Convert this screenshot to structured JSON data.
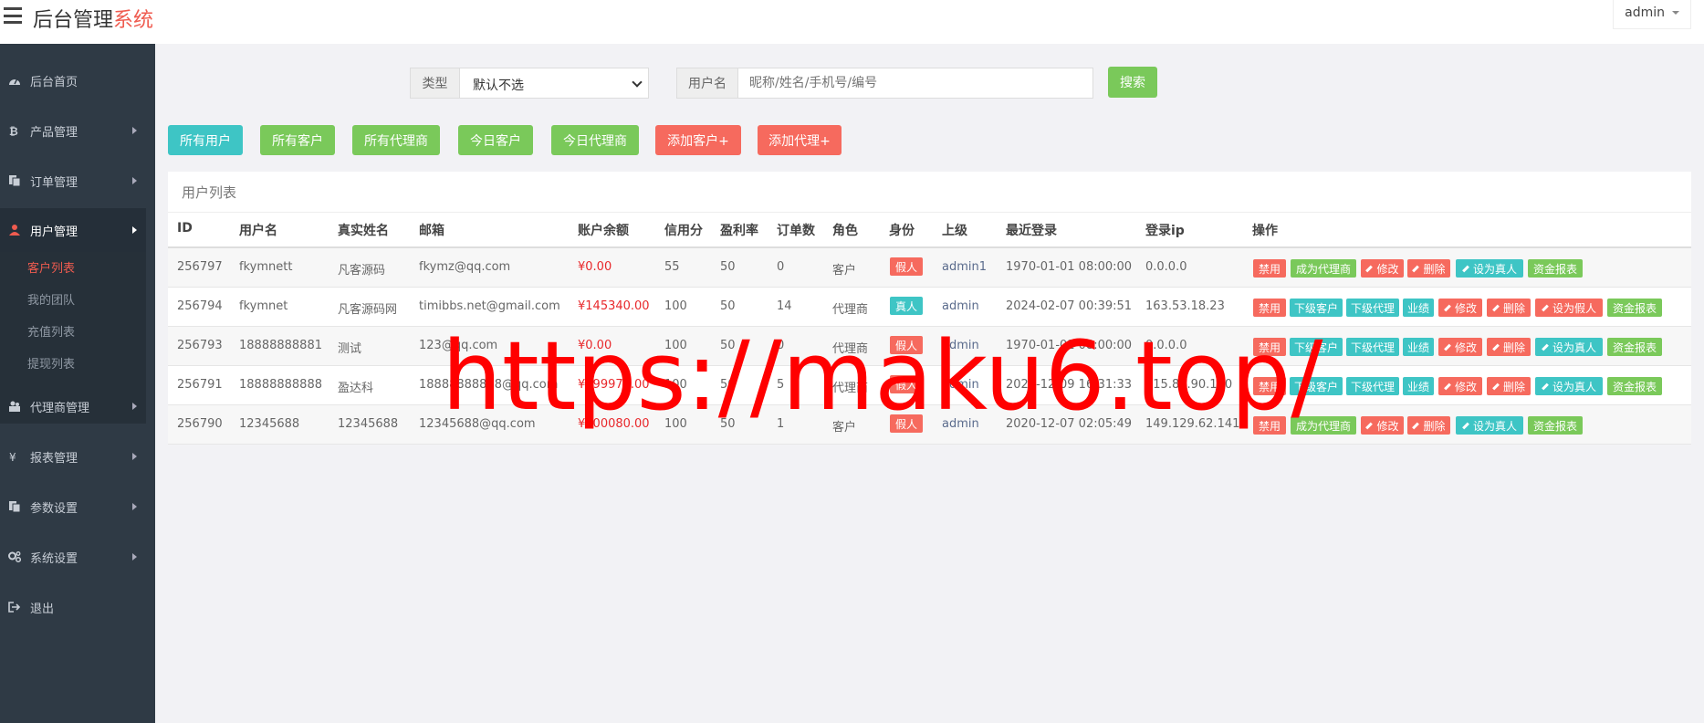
{
  "header": {
    "brand_main": "后台管理",
    "brand_accent": "系统",
    "user": "admin"
  },
  "sidebar": {
    "items": [
      {
        "label": "后台首页"
      },
      {
        "label": "产品管理"
      },
      {
        "label": "订单管理"
      },
      {
        "label": "用户管理"
      },
      {
        "label": "代理商管理"
      },
      {
        "label": "报表管理"
      },
      {
        "label": "参数设置"
      },
      {
        "label": "系统设置"
      },
      {
        "label": "退出"
      }
    ],
    "sub_items": [
      {
        "label": "客户列表"
      },
      {
        "label": "我的团队"
      },
      {
        "label": "充值列表"
      },
      {
        "label": "提现列表"
      }
    ]
  },
  "filters": {
    "type_label": "类型",
    "type_value": "默认不选",
    "username_label": "用户名",
    "username_placeholder": "昵称/姓名/手机号/编号",
    "search_label": "搜索"
  },
  "buttons": {
    "all_users": "所有用户",
    "all_customers": "所有客户",
    "all_agents": "所有代理商",
    "today_customers": "今日客户",
    "today_agents": "今日代理商",
    "add_customer": "添加客户+",
    "add_agent": "添加代理+"
  },
  "table": {
    "title": "用户列表",
    "columns": [
      "ID",
      "用户名",
      "真实姓名",
      "邮箱",
      "账户余额",
      "信用分",
      "盈利率",
      "订单数",
      "角色",
      "身份",
      "上级",
      "最近登录",
      "登录ip",
      "操作"
    ],
    "rows": [
      {
        "id": "256797",
        "username": "fkymnett",
        "realname": "凡客源码",
        "email": "fkymz@qq.com",
        "balance": "¥0.00",
        "credit": "55",
        "profit": "50",
        "orders": "0",
        "role": "客户",
        "identity": "假人",
        "parent": "admin1",
        "last_login": "1970-01-01 08:00:00",
        "ip": "0.0.0.0"
      },
      {
        "id": "256794",
        "username": "fkymnet",
        "realname": "凡客源码网",
        "email": "timibbs.net@gmail.com",
        "balance": "¥145340.00",
        "credit": "100",
        "profit": "50",
        "orders": "14",
        "role": "代理商",
        "identity": "真人",
        "parent": "admin",
        "last_login": "2024-02-07 00:39:51",
        "ip": "163.53.18.23"
      },
      {
        "id": "256793",
        "username": "18888888881",
        "realname": "测试",
        "email": "123@qq.com",
        "balance": "¥0.00",
        "credit": "100",
        "profit": "50",
        "orders": "0",
        "role": "代理商",
        "identity": "假人",
        "parent": "admin",
        "last_login": "1970-01-01 08:00:00",
        "ip": "0.0.0.0"
      },
      {
        "id": "256791",
        "username": "18888888888",
        "realname": "盈达科",
        "email": "18888888888@qq.com",
        "balance": "¥999970.00",
        "credit": "100",
        "profit": "50",
        "orders": "5",
        "role": "代理商",
        "identity": "假人",
        "parent": "admin",
        "last_login": "2020-12-09 16:31:33",
        "ip": "115.84.90.170"
      },
      {
        "id": "256790",
        "username": "12345688",
        "realname": "12345688",
        "email": "12345688@qq.com",
        "balance": "¥100080.00",
        "credit": "100",
        "profit": "50",
        "orders": "1",
        "role": "客户",
        "identity": "假人",
        "parent": "admin",
        "last_login": "2020-12-07 02:05:49",
        "ip": "149.129.62.141"
      }
    ],
    "actions": {
      "disable": "禁用",
      "make_agent": "成为代理商",
      "edit": "修改",
      "delete": "删除",
      "set_real": "设为真人",
      "set_fake": "设为假人",
      "fund_report": "资金报表",
      "sub_customers": "下级客户",
      "sub_agents": "下级代理",
      "performance": "业绩"
    }
  },
  "watermark": "https://maku6.top/",
  "colors": {
    "sidebar": "#2f3a45",
    "accent": "#ef5b4f",
    "teal": "#3ec5c5",
    "green": "#7ac95a",
    "red": "#f66a5e"
  }
}
